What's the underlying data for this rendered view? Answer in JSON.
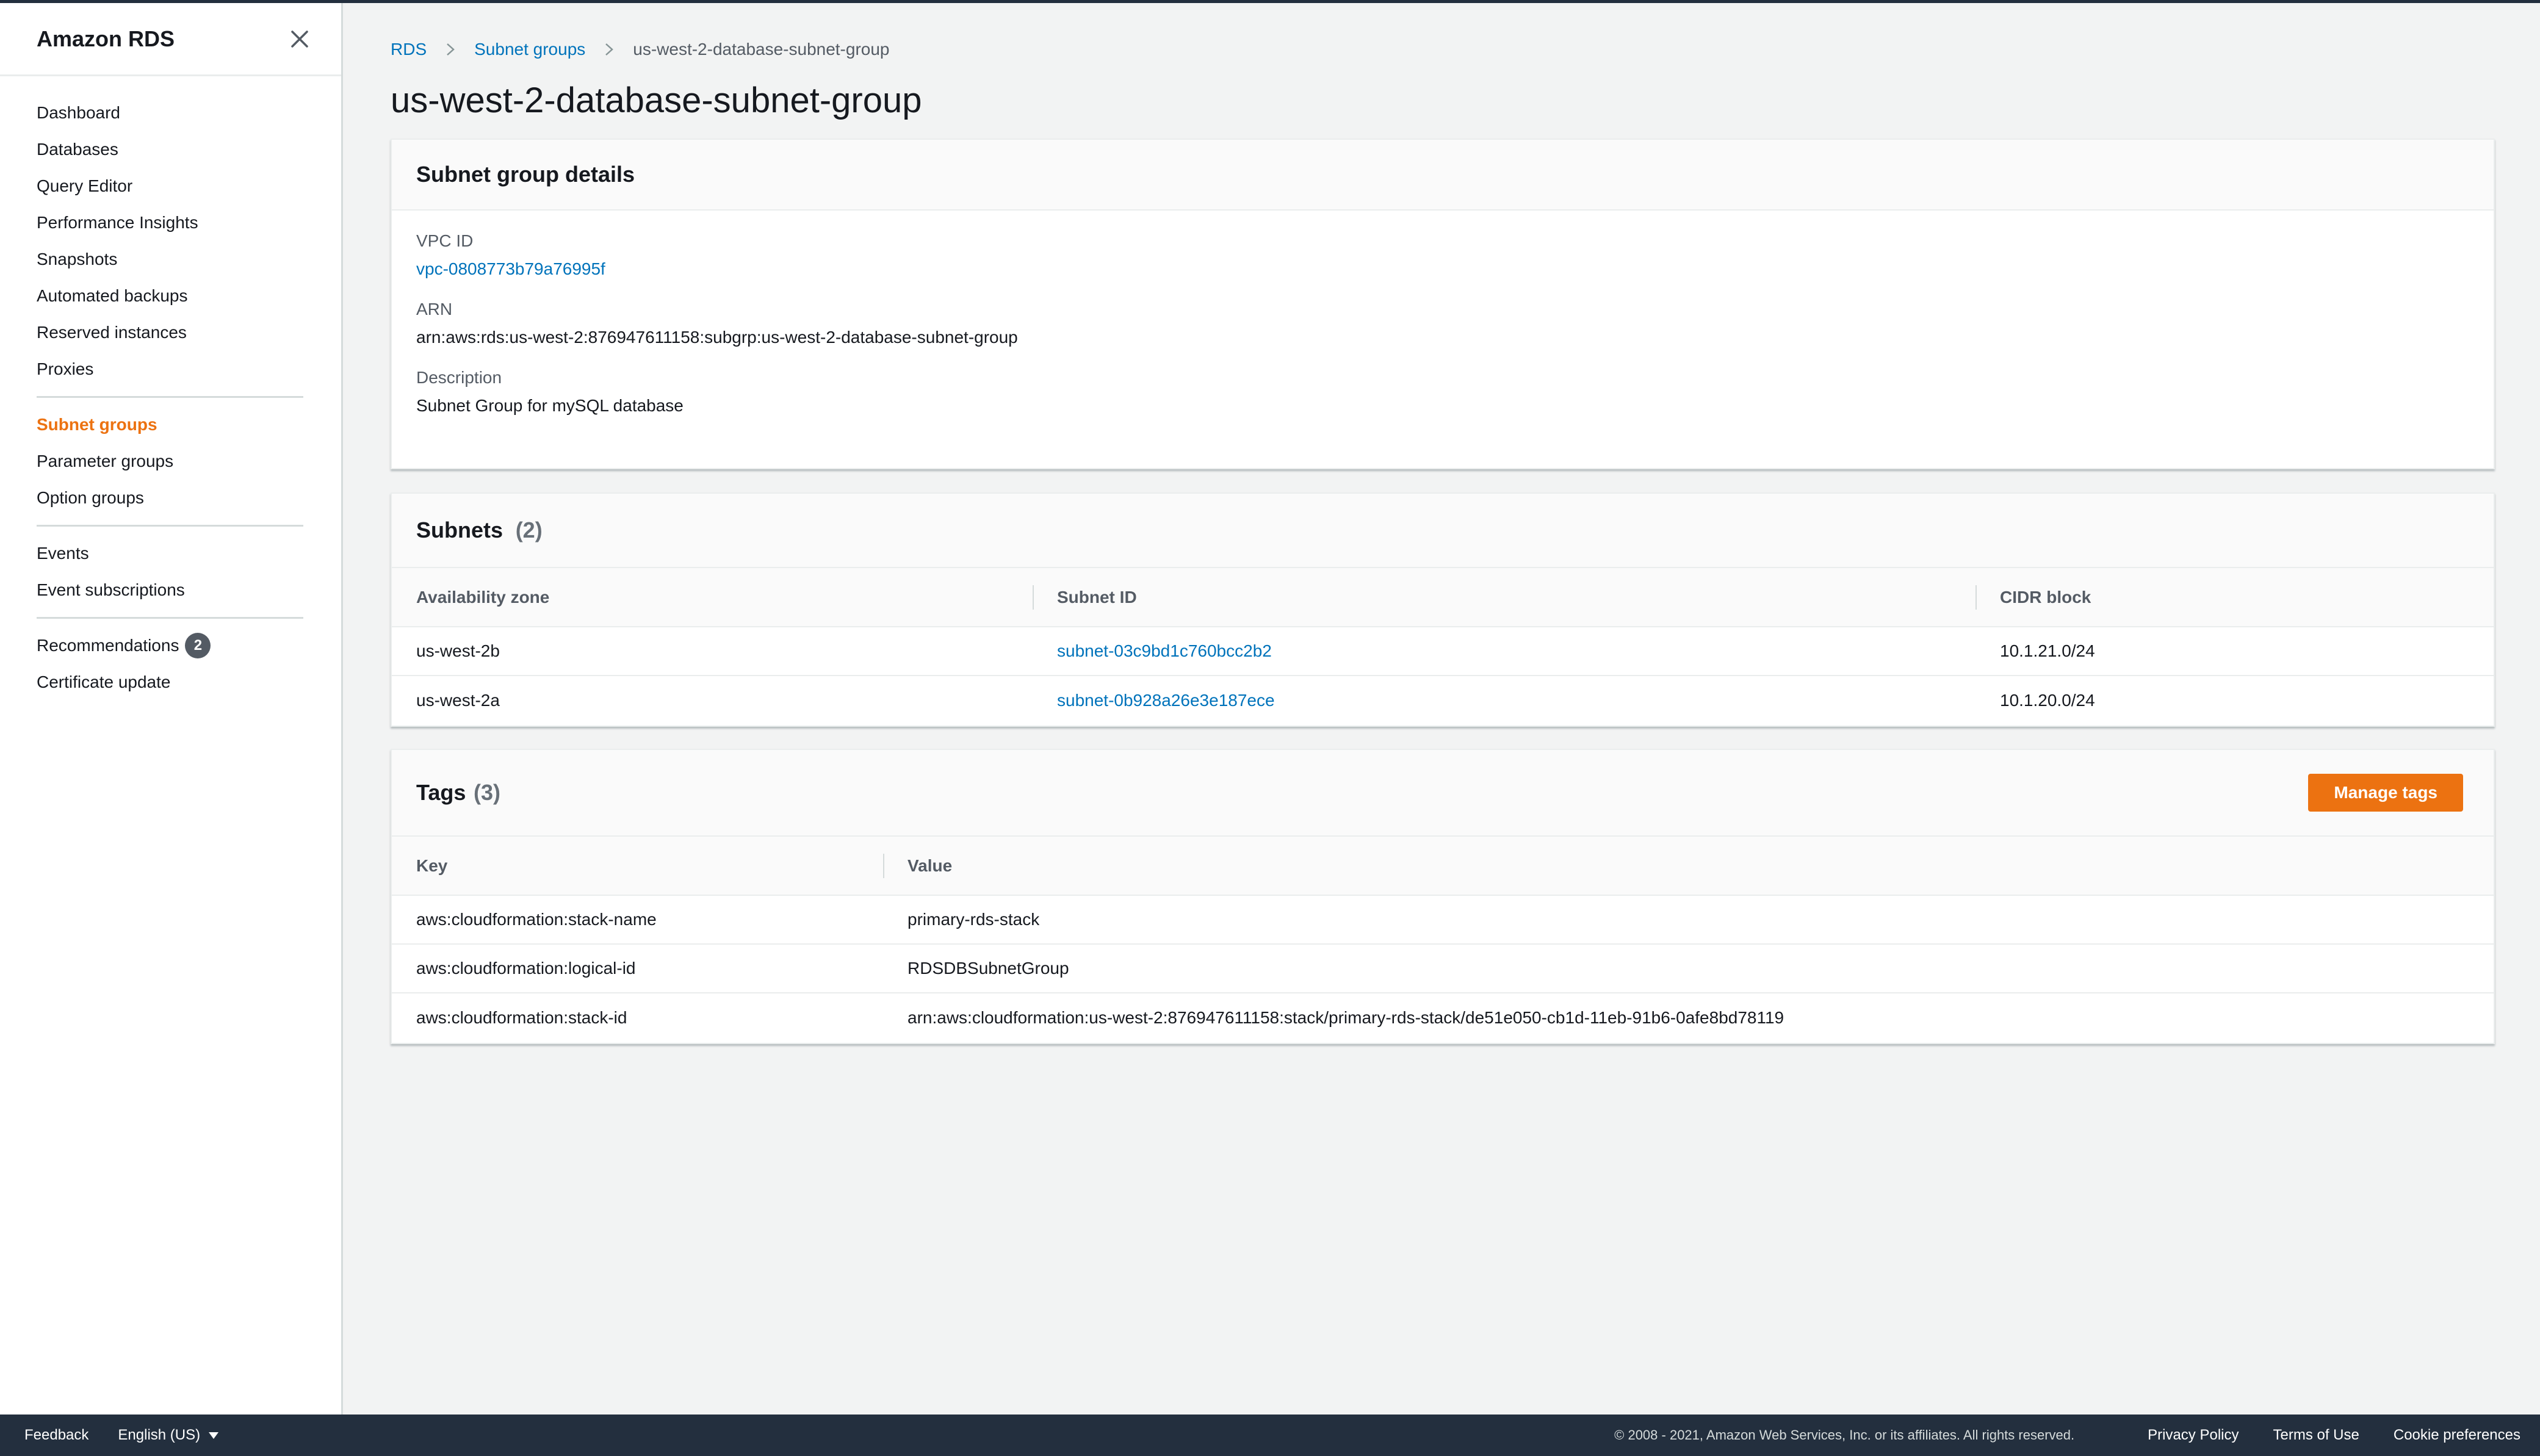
{
  "sidebar": {
    "title": "Amazon RDS",
    "groups": [
      [
        {
          "label": "Dashboard"
        },
        {
          "label": "Databases"
        },
        {
          "label": "Query Editor"
        },
        {
          "label": "Performance Insights"
        },
        {
          "label": "Snapshots"
        },
        {
          "label": "Automated backups"
        },
        {
          "label": "Reserved instances"
        },
        {
          "label": "Proxies"
        }
      ],
      [
        {
          "label": "Subnet groups",
          "active": true
        },
        {
          "label": "Parameter groups"
        },
        {
          "label": "Option groups"
        }
      ],
      [
        {
          "label": "Events"
        },
        {
          "label": "Event subscriptions"
        }
      ],
      [
        {
          "label": "Recommendations",
          "badge": "2"
        },
        {
          "label": "Certificate update"
        }
      ]
    ]
  },
  "breadcrumb": {
    "items": [
      "RDS",
      "Subnet groups"
    ],
    "current": "us-west-2-database-subnet-group"
  },
  "page": {
    "title": "us-west-2-database-subnet-group"
  },
  "details": {
    "title": "Subnet group details",
    "vpc_label": "VPC ID",
    "vpc_value": "vpc-0808773b79a76995f",
    "arn_label": "ARN",
    "arn_value": "arn:aws:rds:us-west-2:876947611158:subgrp:us-west-2-database-subnet-group",
    "desc_label": "Description",
    "desc_value": "Subnet Group for mySQL database"
  },
  "subnets": {
    "title": "Subnets",
    "count": "(2)",
    "columns": [
      "Availability zone",
      "Subnet ID",
      "CIDR block"
    ],
    "rows": [
      [
        "us-west-2b",
        "subnet-03c9bd1c760bcc2b2",
        "10.1.21.0/24"
      ],
      [
        "us-west-2a",
        "subnet-0b928a26e3e187ece",
        "10.1.20.0/24"
      ]
    ]
  },
  "tags": {
    "title": "Tags",
    "count": "(3)",
    "manage_label": "Manage tags",
    "columns": [
      "Key",
      "Value"
    ],
    "rows": [
      [
        "aws:cloudformation:stack-name",
        "primary-rds-stack"
      ],
      [
        "aws:cloudformation:logical-id",
        "RDSDBSubnetGroup"
      ],
      [
        "aws:cloudformation:stack-id",
        "arn:aws:cloudformation:us-west-2:876947611158:stack/primary-rds-stack/de51e050-cb1d-11eb-91b6-0afe8bd78119"
      ]
    ]
  },
  "footer": {
    "feedback": "Feedback",
    "language": "English (US)",
    "copyright": "© 2008 - 2021, Amazon Web Services, Inc. or its affiliates. All rights reserved.",
    "privacy": "Privacy Policy",
    "terms": "Terms of Use",
    "cookies": "Cookie preferences"
  },
  "colors": {
    "accent": "#ec7211",
    "link": "#0073bb",
    "footer_bg": "#232f3e"
  }
}
